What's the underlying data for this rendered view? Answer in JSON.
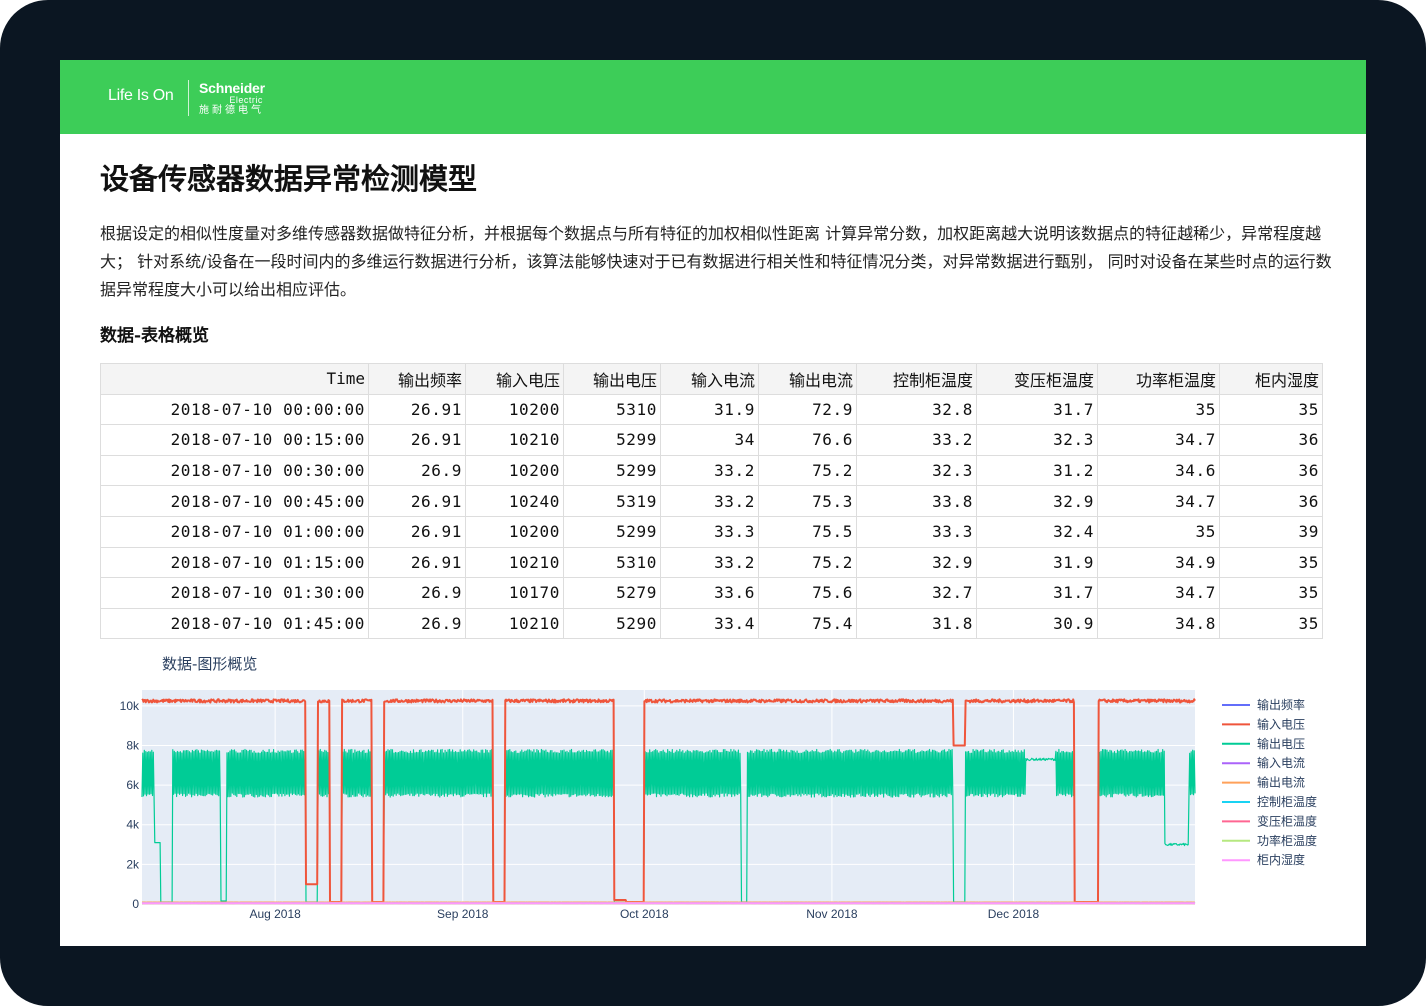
{
  "brand": {
    "tagline": "Life Is On",
    "name": "Schneider",
    "sub": "Electric",
    "cn": "施耐德电气"
  },
  "page": {
    "title": "设备传感器数据异常检测模型",
    "description": "根据设定的相似性度量对多维传感器数据做特征分析，并根据每个数据点与所有特征的加权相似性距离 计算异常分数，加权距离越大说明该数据点的特征越稀少，异常程度越大； 针对系统/设备在一段时间内的多维运行数据进行分析，该算法能够快速对于已有数据进行相关性和特征情况分类，对异常数据进行甄别， 同时对设备在某些时点的运行数据异常程度大小可以给出相应评估。",
    "table_heading": "数据-表格概览",
    "chart_heading": "数据-图形概览"
  },
  "table": {
    "columns": [
      "Time",
      "输出频率",
      "输入电压",
      "输出电压",
      "输入电流",
      "输出电流",
      "控制柜温度",
      "变压柜温度",
      "功率柜温度",
      "柜内湿度"
    ],
    "rows": [
      [
        "2018-07-10 00:00:00",
        "26.91",
        "10200",
        "5310",
        "31.9",
        "72.9",
        "32.8",
        "31.7",
        "35",
        "35"
      ],
      [
        "2018-07-10 00:15:00",
        "26.91",
        "10210",
        "5299",
        "34",
        "76.6",
        "33.2",
        "32.3",
        "34.7",
        "36"
      ],
      [
        "2018-07-10 00:30:00",
        "26.9",
        "10200",
        "5299",
        "33.2",
        "75.2",
        "32.3",
        "31.2",
        "34.6",
        "36"
      ],
      [
        "2018-07-10 00:45:00",
        "26.91",
        "10240",
        "5319",
        "33.2",
        "75.3",
        "33.8",
        "32.9",
        "34.7",
        "36"
      ],
      [
        "2018-07-10 01:00:00",
        "26.91",
        "10200",
        "5299",
        "33.3",
        "75.5",
        "33.3",
        "32.4",
        "35",
        "39"
      ],
      [
        "2018-07-10 01:15:00",
        "26.91",
        "10210",
        "5310",
        "33.2",
        "75.2",
        "32.9",
        "31.9",
        "34.9",
        "35"
      ],
      [
        "2018-07-10 01:30:00",
        "26.9",
        "10170",
        "5279",
        "33.6",
        "75.6",
        "32.7",
        "31.7",
        "34.7",
        "35"
      ],
      [
        "2018-07-10 01:45:00",
        "26.9",
        "10210",
        "5290",
        "33.4",
        "75.4",
        "31.8",
        "30.9",
        "34.8",
        "35"
      ]
    ]
  },
  "chart_data": {
    "type": "line",
    "x_range": [
      "2018-07-10",
      "2018-12-31"
    ],
    "ylim": [
      0,
      10800
    ],
    "y_ticks": [
      0,
      2000,
      4000,
      6000,
      8000,
      10000
    ],
    "y_tick_labels": [
      "0",
      "2k",
      "4k",
      "6k",
      "8k",
      "10k"
    ],
    "x_ticks": [
      "2018-08-01",
      "2018-09-01",
      "2018-10-01",
      "2018-11-01",
      "2018-12-01"
    ],
    "x_tick_labels": [
      "Aug 2018",
      "Sep 2018",
      "Oct 2018",
      "Nov 2018",
      "Dec 2018"
    ],
    "grid": true,
    "legend_position": "right",
    "plot_background": "#e5ecf6",
    "series": [
      {
        "name": "输出频率",
        "color": "#636efa",
        "base": 27,
        "noise": 1
      },
      {
        "name": "输入电压",
        "color": "#ef553b",
        "base": 10250,
        "noise": 80,
        "drops": [
          [
            "2018-08-06",
            "2018-08-07",
            1000
          ],
          [
            "2018-08-10",
            "2018-08-11",
            100
          ],
          [
            "2018-08-17",
            "2018-08-18",
            100
          ],
          [
            "2018-09-06",
            "2018-09-07",
            100
          ],
          [
            "2018-09-26",
            "2018-09-27",
            200
          ],
          [
            "2018-09-28",
            "2018-09-30",
            100
          ],
          [
            "2018-11-21",
            "2018-11-22",
            8000
          ],
          [
            "2018-12-11",
            "2018-12-14",
            100
          ]
        ]
      },
      {
        "name": "输出电压",
        "color": "#00cc96",
        "low": 5400,
        "high": 7800,
        "drops": [
          [
            "2018-07-12",
            "2018-07-12",
            3100
          ],
          [
            "2018-07-13",
            "2018-07-14",
            100
          ],
          [
            "2018-07-23",
            "2018-07-23",
            150
          ],
          [
            "2018-08-06",
            "2018-08-07",
            100
          ],
          [
            "2018-08-10",
            "2018-08-11",
            100
          ],
          [
            "2018-08-17",
            "2018-08-18",
            100
          ],
          [
            "2018-09-06",
            "2018-09-07",
            100
          ],
          [
            "2018-09-26",
            "2018-09-30",
            100
          ],
          [
            "2018-10-17",
            "2018-10-17",
            100
          ],
          [
            "2018-11-21",
            "2018-11-22",
            100
          ],
          [
            "2018-12-11",
            "2018-12-14",
            100
          ]
        ],
        "plateaus": [
          [
            "2018-12-03",
            "2018-12-07",
            7300
          ],
          [
            "2018-12-26",
            "2018-12-29",
            3000
          ]
        ]
      },
      {
        "name": "输入电流",
        "color": "#ab63fa",
        "base": 33,
        "noise": 2
      },
      {
        "name": "输出电流",
        "color": "#ffa15a",
        "base": 75,
        "noise": 3
      },
      {
        "name": "控制柜温度",
        "color": "#19d3f3",
        "base": 32,
        "noise": 2
      },
      {
        "name": "变压柜温度",
        "color": "#ff6692",
        "base": 31,
        "noise": 2
      },
      {
        "name": "功率柜温度",
        "color": "#b6e880",
        "base": 34,
        "noise": 2
      },
      {
        "name": "柜内湿度",
        "color": "#ff97ff",
        "base": 36,
        "noise": 3
      }
    ]
  }
}
